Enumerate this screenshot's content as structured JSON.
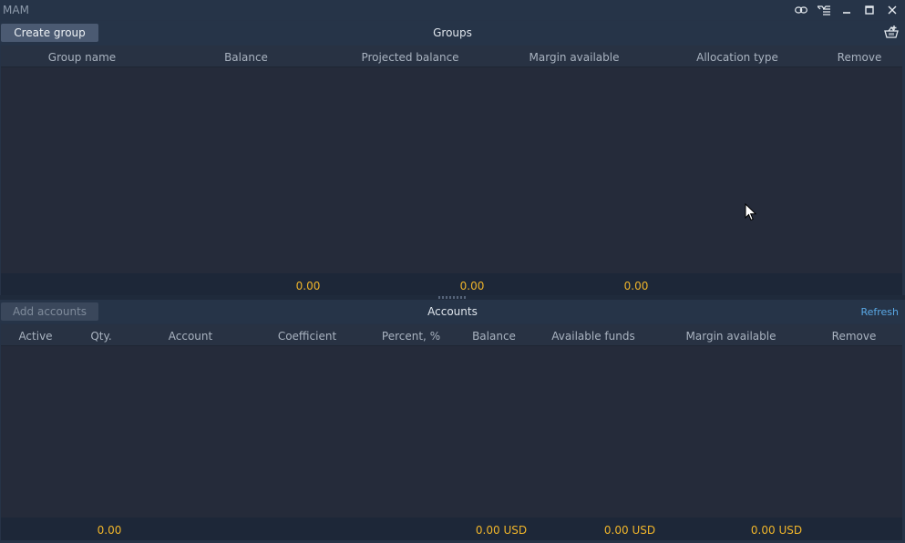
{
  "window": {
    "title": "MAM"
  },
  "groups": {
    "create_label": "Create group",
    "title": "Groups",
    "columns": [
      "Group name",
      "Balance",
      "Projected balance",
      "Margin available",
      "Allocation type",
      "Remove"
    ],
    "totals": [
      "0.00",
      "0.00",
      "0.00"
    ]
  },
  "accounts": {
    "add_label": "Add accounts",
    "title": "Accounts",
    "refresh_label": "Refresh",
    "columns": [
      "Active",
      "Qty.",
      "Account",
      "Coefficient",
      "Percent, %",
      "Balance",
      "Available funds",
      "Margin available",
      "Remove"
    ],
    "totals": [
      "0.00",
      "0.00 USD",
      "0.00 USD",
      "0.00 USD"
    ]
  },
  "colors": {
    "accent": "#5aa9e6",
    "total_text": "#f0b52a",
    "panel_bg": "#252b3a"
  },
  "icons": [
    "link-icon",
    "settings-menu-icon",
    "minimize-icon",
    "maximize-icon",
    "close-icon",
    "add-basket-icon"
  ]
}
